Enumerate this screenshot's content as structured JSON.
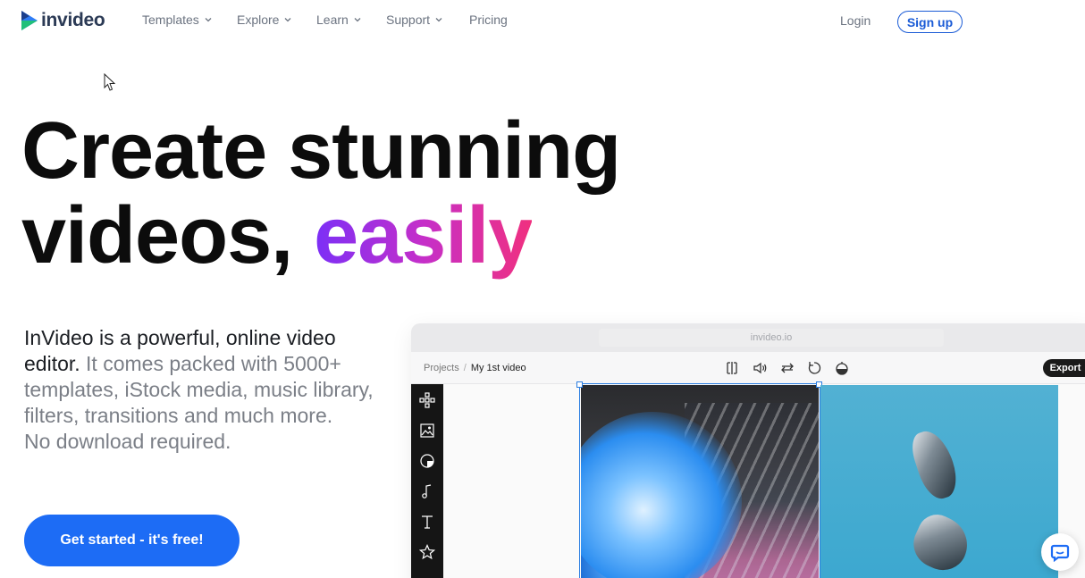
{
  "brand": {
    "name": "invideo"
  },
  "nav": {
    "items": [
      {
        "label": "Templates",
        "dropdown": true
      },
      {
        "label": "Explore",
        "dropdown": true
      },
      {
        "label": "Learn",
        "dropdown": true
      },
      {
        "label": "Support",
        "dropdown": true
      },
      {
        "label": "Pricing",
        "dropdown": false
      }
    ],
    "login": "Login",
    "signup": "Sign up"
  },
  "hero": {
    "line1": "Create stunning",
    "line2_prefix": "videos, ",
    "line2_highlight": "easily"
  },
  "description": {
    "strong": "InVideo is a powerful, online video editor.",
    "rest": " It comes packed with 5000+ templates, iStock media, music library, filters, transitions and much more.",
    "line2": "No download required."
  },
  "cta": {
    "label": "Get started - it's free!"
  },
  "editor": {
    "url": "invideo.io",
    "breadcrumb": {
      "root": "Projects",
      "separator": "/",
      "current": "My 1st video"
    },
    "export": "Export",
    "toolbar_icons": [
      "split-icon",
      "volume-icon",
      "swap-icon",
      "rotate-icon",
      "opacity-icon"
    ],
    "sidebar_icons": [
      "layout-icon",
      "media-icon",
      "sticker-icon",
      "music-icon",
      "text-icon",
      "star-icon"
    ]
  },
  "colors": {
    "primary": "#1d6cf5",
    "signup_border": "#1a5bd6",
    "gradient_start": "#7b2ff7",
    "gradient_end": "#f0307f"
  }
}
